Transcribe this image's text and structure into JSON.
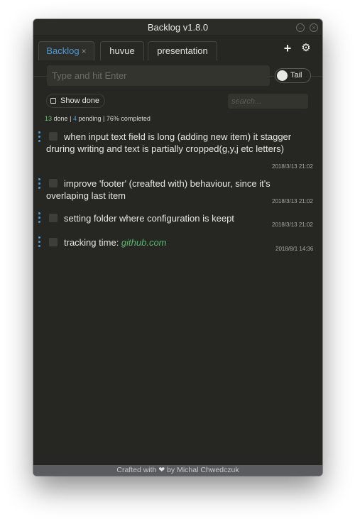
{
  "window": {
    "title": "Backlog v1.8.0"
  },
  "tabs": [
    {
      "label": "Backlog",
      "close": "×",
      "active": true
    },
    {
      "label": "huvue",
      "active": false
    },
    {
      "label": "presentation",
      "active": false
    }
  ],
  "toolbar": {
    "add_icon": "plus-icon",
    "add_glyph": "+",
    "settings_icon": "gear-icon",
    "settings_glyph": "⚙"
  },
  "new_item": {
    "placeholder": "Type and hit Enter",
    "value": ""
  },
  "tail_toggle": {
    "label": "Tail",
    "on": false
  },
  "filter": {
    "show_done_label": "Show done",
    "checked": false
  },
  "search": {
    "placeholder": "search...",
    "value": ""
  },
  "stats": {
    "done": "13",
    "done_label": "done",
    "pending": "4",
    "pending_label": "pending",
    "completed": "76% completed",
    "sep": "|"
  },
  "items": [
    {
      "text": "when input text field is long (adding new item) it stagger druring writing and text is partially cropped(g,y,j etc letters)",
      "date": "2018/3/13 21:02",
      "done": false
    },
    {
      "text": "improve 'footer' (creafted with) behaviour, since it's overlaping last item",
      "date": "2018/3/13 21:02",
      "done": false
    },
    {
      "text": "setting folder where configuration is keept",
      "date": "2018/3/13 21:02",
      "done": false
    },
    {
      "text_prefix": "tracking time: ",
      "link": "github.com",
      "date": "2018/8/1 14:36",
      "done": false
    }
  ],
  "footer": {
    "prefix": "Crafted with",
    "heart": "❤",
    "suffix": "by Michal Chwedczuk"
  },
  "colors": {
    "accent": "#4d9ad6",
    "link": "#59b86d",
    "background": "#262623",
    "footer": "#5a5c60"
  }
}
